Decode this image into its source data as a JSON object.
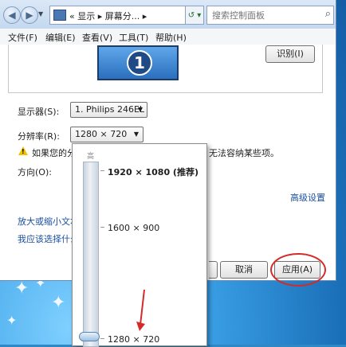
{
  "address_bar": {
    "back_label": "◀",
    "forward_label": "▶",
    "breadcrumb": "«  显示  ▸  屏幕分...  ▸",
    "refresh_icon": "↺ ▾",
    "search_placeholder": "搜索控制面板"
  },
  "menu": {
    "items": [
      "文件(F)",
      "编辑(E)",
      "查看(V)",
      "工具(T)",
      "帮助(H)"
    ]
  },
  "preview": {
    "monitor_number": "1",
    "identify_button": "识别(I)"
  },
  "settings": {
    "display_label": "显示器(S):",
    "display_value": "1. Philips 246EL",
    "resolution_label": "分辨率(R):",
    "resolution_value": "1280 × 720",
    "warning_text_left": "如果您的分",
    "warning_text_right": "无法容纳某些项。",
    "orientation_label": "方向(O):",
    "advanced_link": "高级设置",
    "link_text_size": "放大或缩小文本",
    "link_which": "我应该选择什么"
  },
  "buttons": {
    "cancel": "取消",
    "apply": "应用(A)"
  },
  "resolution_popup": {
    "high_label": "高",
    "options": [
      {
        "label": "1920 × 1080 (推荐)",
        "bold": true
      },
      {
        "label": "1600 × 900",
        "bold": false
      },
      {
        "label": "1280 × 720",
        "bold": false
      }
    ],
    "selected": "1280 × 720"
  },
  "colors": {
    "annotation_red": "#d42a2a",
    "link_blue": "#1a4fa0",
    "warning_yellow": "#f2c200"
  }
}
